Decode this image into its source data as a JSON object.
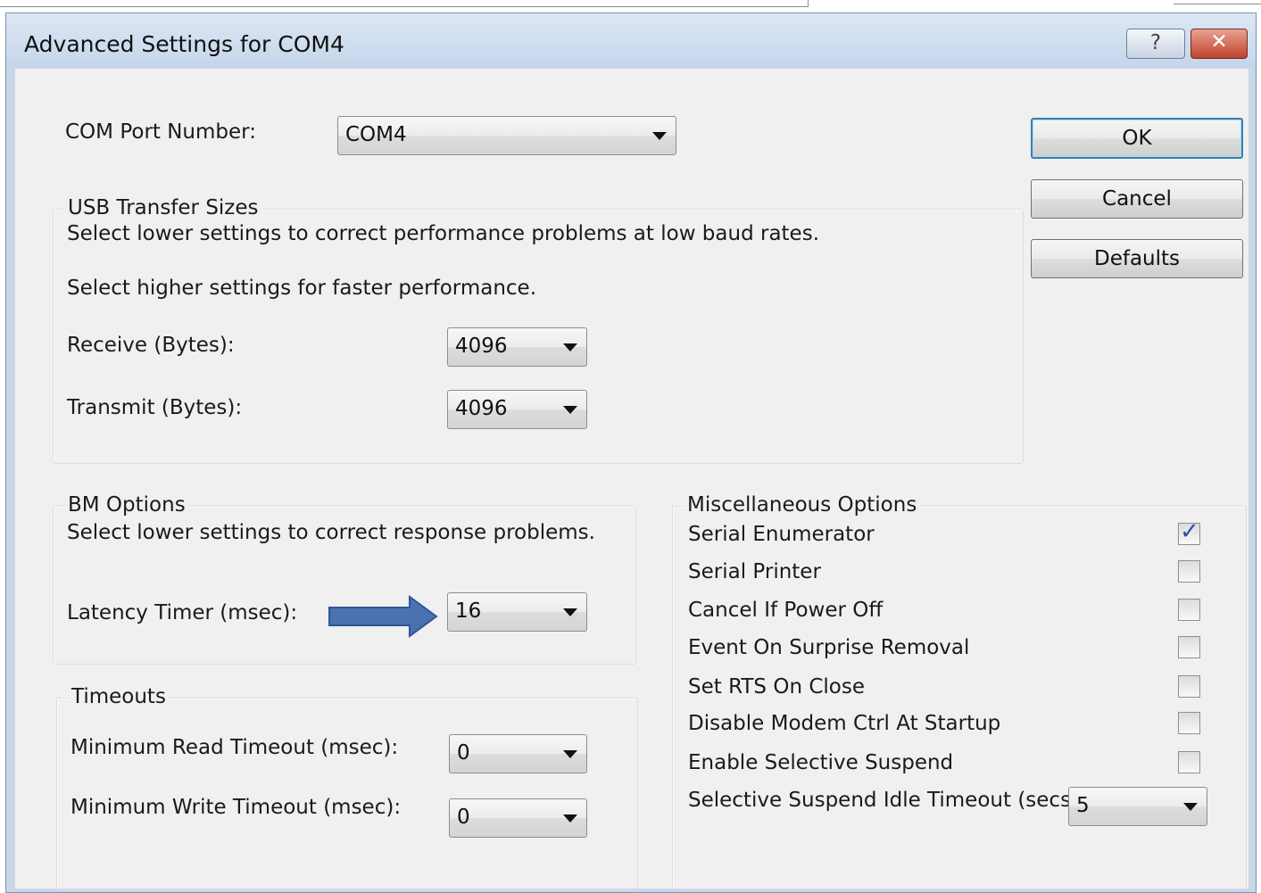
{
  "window": {
    "title": "Advanced Settings for COM4",
    "help_symbol": "?",
    "close_symbol": "✕"
  },
  "com_port": {
    "label": "COM Port Number:",
    "value": "COM4"
  },
  "buttons": {
    "ok": "OK",
    "cancel": "Cancel",
    "defaults": "Defaults"
  },
  "usb_transfer": {
    "legend": "USB Transfer Sizes",
    "line1": "Select lower settings to correct performance problems at low baud rates.",
    "line2": "Select higher settings for faster performance.",
    "receive_label": "Receive (Bytes):",
    "receive_value": "4096",
    "transmit_label": "Transmit (Bytes):",
    "transmit_value": "4096"
  },
  "bm_options": {
    "legend": "BM Options",
    "description": "Select lower settings to correct response problems.",
    "latency_label": "Latency Timer (msec):",
    "latency_value": "16",
    "arrow_color": "#4a72b0"
  },
  "timeouts": {
    "legend": "Timeouts",
    "read_label": "Minimum Read Timeout (msec):",
    "read_value": "0",
    "write_label": "Minimum Write Timeout (msec):",
    "write_value": "0"
  },
  "misc": {
    "legend": "Miscellaneous Options",
    "options": [
      {
        "label": "Serial Enumerator",
        "checked": true
      },
      {
        "label": "Serial Printer",
        "checked": false
      },
      {
        "label": "Cancel If Power Off",
        "checked": false
      },
      {
        "label": "Event On Surprise Removal",
        "checked": false
      },
      {
        "label": "Set RTS On Close",
        "checked": false
      },
      {
        "label": "Disable Modem Ctrl At Startup",
        "checked": false
      },
      {
        "label": "Enable Selective Suspend",
        "checked": false
      }
    ],
    "idle_timeout_label": "Selective Suspend Idle Timeout (secs):",
    "idle_timeout_value": "5"
  },
  "colors": {
    "title_bar": "#c9d7e9",
    "dialog_bg": "#f0f0f0",
    "close_button": "#c0432c",
    "default_button_border": "#3c7fb1",
    "check_mark": "#2b4fa8"
  }
}
